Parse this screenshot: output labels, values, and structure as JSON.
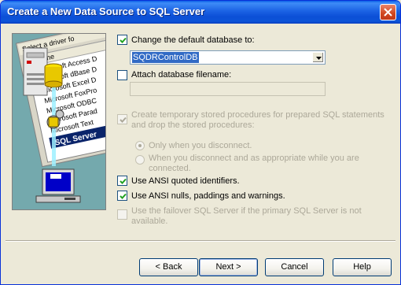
{
  "window": {
    "title": "Create a New Data Source to SQL Server"
  },
  "illustration": {
    "list_header": "Select a driver fo",
    "list_column": "Name",
    "drivers": [
      "Microsoft Access D",
      "Microsoft dBase D",
      "Microsoft Excel D",
      "Microsoft FoxPro",
      "Microsoft ODBC",
      "Microsoft Parad",
      "Microsoft Text",
      "SQL Server"
    ]
  },
  "options": {
    "change_default_db": {
      "label": "Change the default database to:",
      "checked": true
    },
    "database_select": {
      "value": "SQDRControlDB"
    },
    "attach_db_filename": {
      "label": "Attach database filename:",
      "checked": false
    },
    "attach_db_value": "",
    "temp_procs": {
      "line1": "Create temporary stored procedures for prepared SQL statements",
      "line2": "and drop the stored procedures:",
      "checked": true,
      "enabled": false
    },
    "radio_disconnect": {
      "label": "Only when you disconnect.",
      "selected": true,
      "enabled": false
    },
    "radio_appropriate": {
      "line1": "When you disconnect and as appropriate while you are",
      "line2": "connected.",
      "selected": false,
      "enabled": false
    },
    "ansi_quoted": {
      "label": "Use ANSI quoted identifiers.",
      "checked": true
    },
    "ansi_nulls": {
      "label": "Use ANSI nulls, paddings and warnings.",
      "checked": true
    },
    "failover": {
      "line1": "Use the failover SQL Server if the primary SQL Server is not",
      "line2": "available.",
      "checked": false,
      "enabled": false
    }
  },
  "buttons": {
    "back": "< Back",
    "next": "Next >",
    "cancel": "Cancel",
    "help": "Help"
  },
  "colors": {
    "titlebar": "#0b4fd6",
    "selection": "#316ac5",
    "dialog_bg": "#ece9d8"
  }
}
